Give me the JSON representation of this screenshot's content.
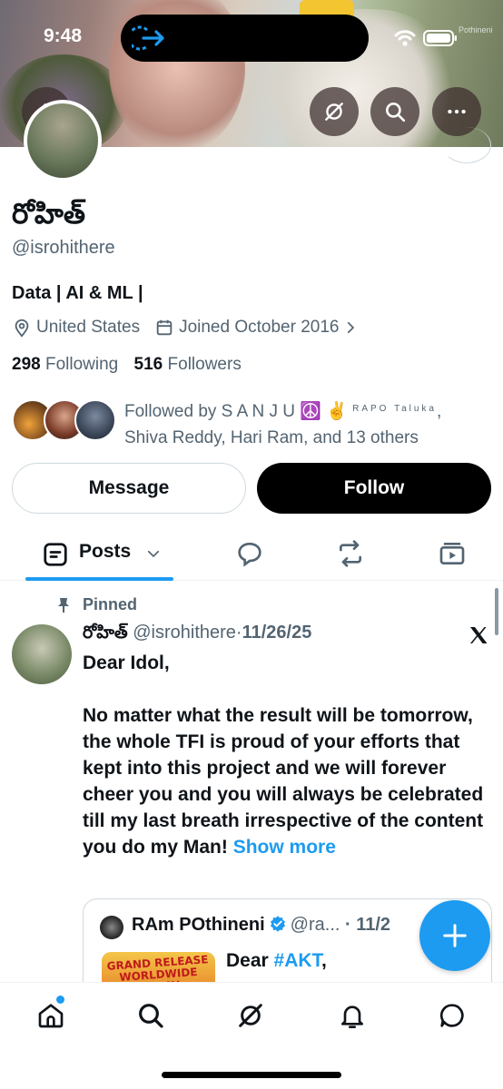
{
  "status_bar": {
    "time": "9:48",
    "banner_label": "Pothineni"
  },
  "profile": {
    "name": "రోహిత్",
    "handle": "@isrohithere",
    "bio": "Data | AI & ML |",
    "location": "United States",
    "joined": "Joined October 2016",
    "following_count": "298",
    "following_label": "Following",
    "followers_count": "516",
    "followers_label": "Followers",
    "followed_by_prefix": "Followed by S A N J U",
    "followed_by_emoji": "☮️ ✌️",
    "followed_by_small": "RAPO Taluka",
    "followed_by_rest": "Shiva Reddy, Hari Ram, and 13 others"
  },
  "actions": {
    "message_label": "Message",
    "follow_label": "Follow"
  },
  "tabs": {
    "posts_label": "Posts"
  },
  "post": {
    "pinned_label": "Pinned",
    "author_name": "రోహిత్",
    "author_handle": "@isrohithere",
    "separator": "·",
    "date": "11/26/25",
    "body": "Dear Idol,\n\nNo matter what the result will be tomorrow, the whole TFI is proud of your efforts that kept into this project and we will forever cheer you and you will always be celebrated till my last breath irrespective of the content you do my Man! ",
    "show_more": "Show more"
  },
  "quote": {
    "author_name": "RAm POthineni",
    "author_handle": "@ra...",
    "date": "· 11/2",
    "image_text": "GRAND RELEASE WORLDWIDE TODAY",
    "text_prefix": "Dear ",
    "hashtag": "#AKT",
    "text_suffix": ","
  },
  "colors": {
    "accent": "#1d9bf0",
    "secondary_text": "#536471",
    "primary_text": "#0f1419",
    "follow_button": "#000000"
  }
}
